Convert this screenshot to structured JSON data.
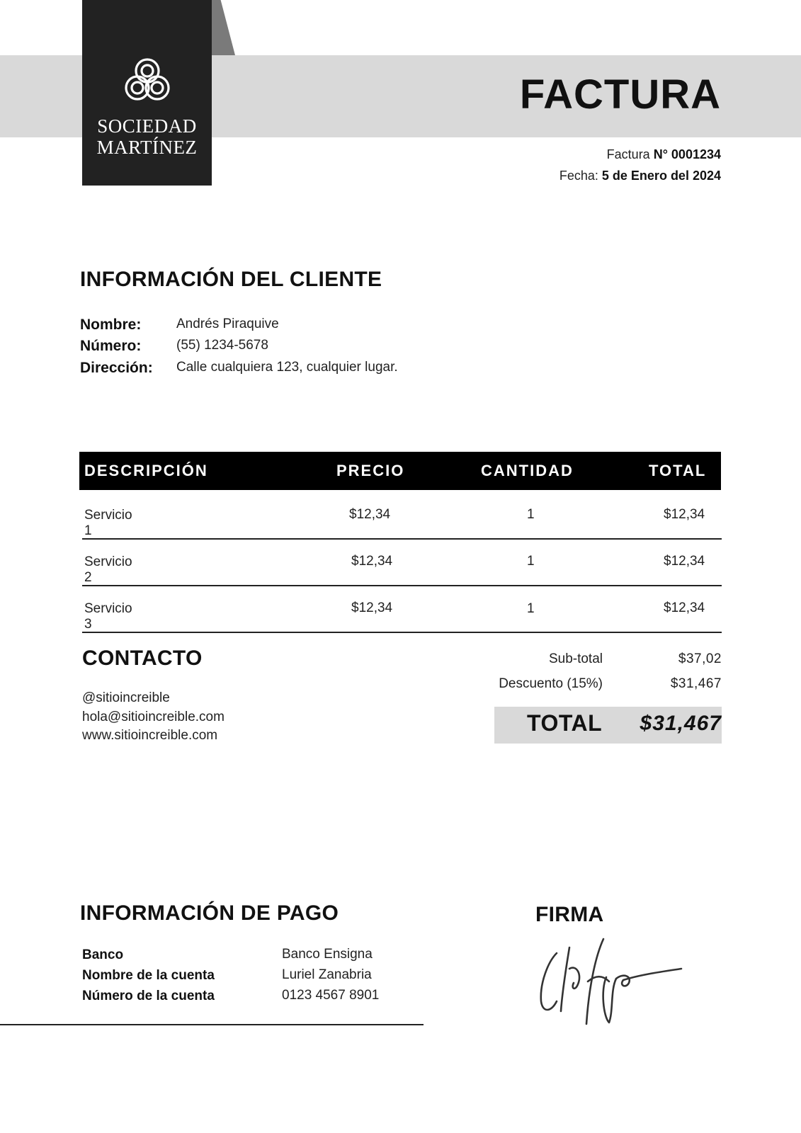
{
  "header": {
    "logo_line1": "SOCIEDAD",
    "logo_line2": "MARTÍNEZ",
    "title": "FACTURA",
    "invoice_label": "Factura",
    "invoice_number": "N° 0001234",
    "date_label": "Fecha:",
    "date_value": "5 de Enero del 2024"
  },
  "client": {
    "title": "INFORMACIÓN DEL CLIENTE",
    "rows": [
      {
        "label": "Nombre:",
        "value": "Andrés Piraquive"
      },
      {
        "label": "Número:",
        "value": "(55) 1234-5678"
      },
      {
        "label": "Dirección:",
        "value": "Calle cualquiera 123, cualquier lugar."
      }
    ]
  },
  "table": {
    "headers": [
      "DESCRIPCIÓN",
      "PRECIO",
      "CANTIDAD",
      "TOTAL"
    ],
    "rows": [
      {
        "description": "Servicio 1",
        "price": "$12,34",
        "quantity": "1",
        "total": "$12,34"
      },
      {
        "description": "Servicio 2",
        "price": "$12,34",
        "quantity": "1",
        "total": "$12,34"
      },
      {
        "description": "Servicio 3",
        "price": "$12,34",
        "quantity": "1",
        "total": "$12,34"
      }
    ]
  },
  "contact": {
    "title": "CONTACTO",
    "lines": [
      "@sitioincreible",
      "hola@sitioincreible.com",
      "www.sitioincreible.com"
    ]
  },
  "summary": {
    "subtotal_label": "Sub-total",
    "subtotal_value": "$37,02",
    "discount_label": "Descuento (15%)",
    "discount_value": "$31,467",
    "total_label": "TOTAL",
    "total_value": "$31,467"
  },
  "payment": {
    "title": "INFORMACIÓN DE PAGO",
    "rows": [
      {
        "label": "Banco",
        "value": "Banco Ensigna"
      },
      {
        "label": "Nombre de la cuenta",
        "value": "Luriel Zanabria"
      },
      {
        "label": "Número de la cuenta",
        "value": "0123 4567 8901"
      }
    ]
  },
  "signature": {
    "title": "FIRMA"
  },
  "colors": {
    "band": "#d9d9d9",
    "logo_bg": "#222222",
    "table_header": "#000000"
  }
}
